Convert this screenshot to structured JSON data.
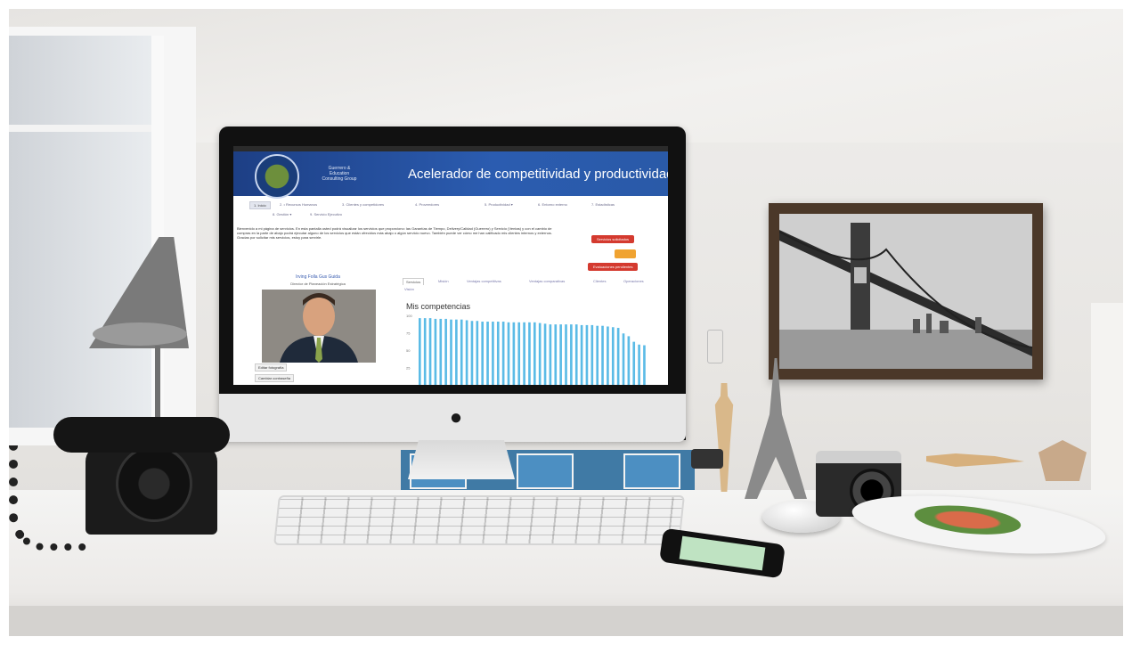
{
  "screen": {
    "brand_lines": [
      "Guerrero &",
      "Education",
      "Consulting Group"
    ],
    "header_title": "Acelerador de competitividad y productividad",
    "nav": [
      {
        "label": "1. Inicio",
        "active": true
      },
      {
        "label": "2. • Recursos Humanos"
      },
      {
        "label": "3. Clientes y competidores"
      },
      {
        "label": "4. Proveedores"
      },
      {
        "label": "5. Productividad ▾"
      },
      {
        "label": "6. Entorno externo"
      },
      {
        "label": "7. Estadísticas"
      },
      {
        "label": "8. Gestión ▾"
      },
      {
        "label": "9. Servicio Ejecutivo"
      }
    ],
    "welcome_text": "Bienvenido a mi página de servicios. En esta pantalla usted podrá visualizar los servicios que proporciono: las Garantías de Tiempo, Delivery/Calidad (Guerrero) y Servicio (Ventas) y con el cambio de compras en la parte de abajo podrá ejecutar alguno de los servicios que están ofrecidos más abajo o algún servicio nuevo. También puede ver cómo me han calificado mis clientes internos y externos. Gracias por solicitar mis servicios, estoy para servirle.",
    "btn_requested": "Servicios solicitados",
    "btn_evaluations": "Evaluaciones pendientes",
    "profile_name": "Irving Folla Gus Guida",
    "profile_role": "Director de Planeación Estratégica",
    "btn_edit_photo": "Editar fotografía",
    "btn_change_password": "Cambiar contraseña",
    "tabs": [
      {
        "label": "Servicios",
        "active": true
      },
      {
        "label": "Misión"
      },
      {
        "label": "Ventajas competitivas"
      },
      {
        "label": "Ventajas comparativas"
      },
      {
        "label": "Clientes"
      },
      {
        "label": "Operaciones"
      },
      {
        "label": "Visión"
      }
    ],
    "chart_title": "Mis competencias"
  },
  "chart_data": {
    "type": "bar",
    "title": "Mis competencias",
    "ylim": [
      0,
      100
    ],
    "yticks": [
      "100",
      "75",
      "50",
      "25"
    ],
    "values": [
      96,
      96,
      96,
      95,
      95,
      95,
      94,
      94,
      94,
      93,
      92,
      92,
      91,
      91,
      91,
      91,
      91,
      90,
      90,
      90,
      90,
      90,
      90,
      89,
      88,
      87,
      87,
      87,
      87,
      87,
      87,
      86,
      86,
      86,
      85,
      85,
      84,
      83,
      82,
      74,
      70,
      62,
      58,
      57
    ]
  },
  "colors": {
    "header_blue": "#2b5cb0",
    "button_red": "#d43a2f",
    "button_orange": "#f0a331",
    "bar_blue": "#5bbbe6"
  }
}
